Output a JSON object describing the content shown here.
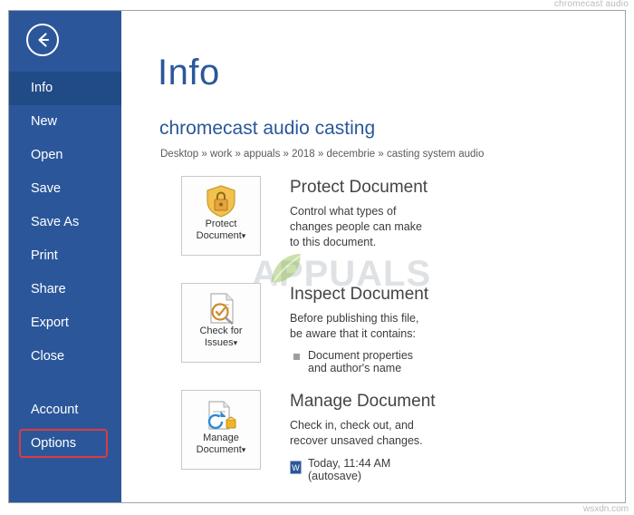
{
  "watermarks": {
    "top_right": "chromecast audio",
    "bottom_right": "wsxdn.com",
    "center": "APPUALS"
  },
  "nav": {
    "back_icon": "back-arrow-icon",
    "items": [
      {
        "label": "Info",
        "selected": true
      },
      {
        "label": "New",
        "selected": false
      },
      {
        "label": "Open",
        "selected": false
      },
      {
        "label": "Save",
        "selected": false
      },
      {
        "label": "Save As",
        "selected": false
      },
      {
        "label": "Print",
        "selected": false
      },
      {
        "label": "Share",
        "selected": false
      },
      {
        "label": "Export",
        "selected": false
      },
      {
        "label": "Close",
        "selected": false
      }
    ],
    "footer_items": [
      {
        "label": "Account",
        "highlighted": false
      },
      {
        "label": "Options",
        "highlighted": true
      }
    ],
    "highlight_color": "#e03a3e",
    "rail_color": "#2b579a",
    "selected_color": "#204b86"
  },
  "main": {
    "page_title": "Info",
    "document_name": "chromecast audio casting",
    "breadcrumb": "Desktop » work » appuals » 2018 » decembrie » casting system audio",
    "sections": [
      {
        "id": "protect-document",
        "button_label_line1": "Protect",
        "button_label_line2": "Document",
        "button_caret": "▾",
        "icon": "lock-shield-icon",
        "title": "Protect Document",
        "description": "Control what types of changes people can make to this document."
      },
      {
        "id": "inspect-document",
        "button_label_line1": "Check for",
        "button_label_line2": "Issues",
        "button_caret": "▾",
        "icon": "document-magnifier-icon",
        "title": "Inspect Document",
        "description": "Before publishing this file, be aware that it contains:",
        "bullets": [
          "Document properties and author's name"
        ]
      },
      {
        "id": "manage-document",
        "button_label_line1": "Manage",
        "button_label_line2": "Document",
        "button_caret": "▾",
        "icon": "document-recover-icon",
        "title": "Manage Document",
        "description": "Check in, check out, and recover unsaved changes.",
        "versions": [
          {
            "icon": "word-doc-icon",
            "label": "Today, 11:44 AM (autosave)"
          }
        ]
      }
    ]
  }
}
